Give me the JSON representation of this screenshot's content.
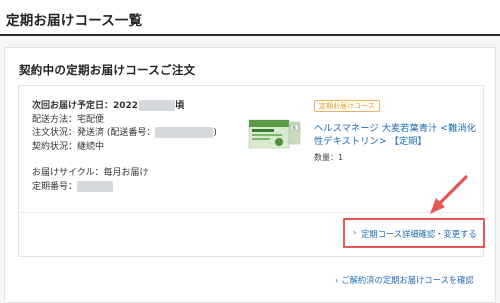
{
  "page": {
    "title": "定期お届けコース一覧"
  },
  "section": {
    "title": "契約中の定期お届けコースご注文"
  },
  "order": {
    "next_delivery_label": "次回お届け予定日：2022",
    "next_delivery_suffix": "頃",
    "delivery_method": "配送方法：宅配便",
    "order_status_label": "注文状況：発送済 (配送番号：",
    "order_status_suffix": ")",
    "contract_status": "契約状況：継続中",
    "cycle": "お届けサイクル：毎月お届け",
    "regular_number_label": "定期番号："
  },
  "product": {
    "badge": "定期お届けコース",
    "name": "ヘルスマネージ 大麦若葉青汁 <難消化性デキストリン> 【定期】",
    "quantity": "数量：1"
  },
  "actions": {
    "change_label": "定期コース詳細確認・変更する",
    "cancelled_label": "ご解約済の定期お届けコースを確認"
  },
  "colors": {
    "link": "#1f6db5",
    "highlight": "#e85656",
    "badge": "#e69a2c"
  }
}
